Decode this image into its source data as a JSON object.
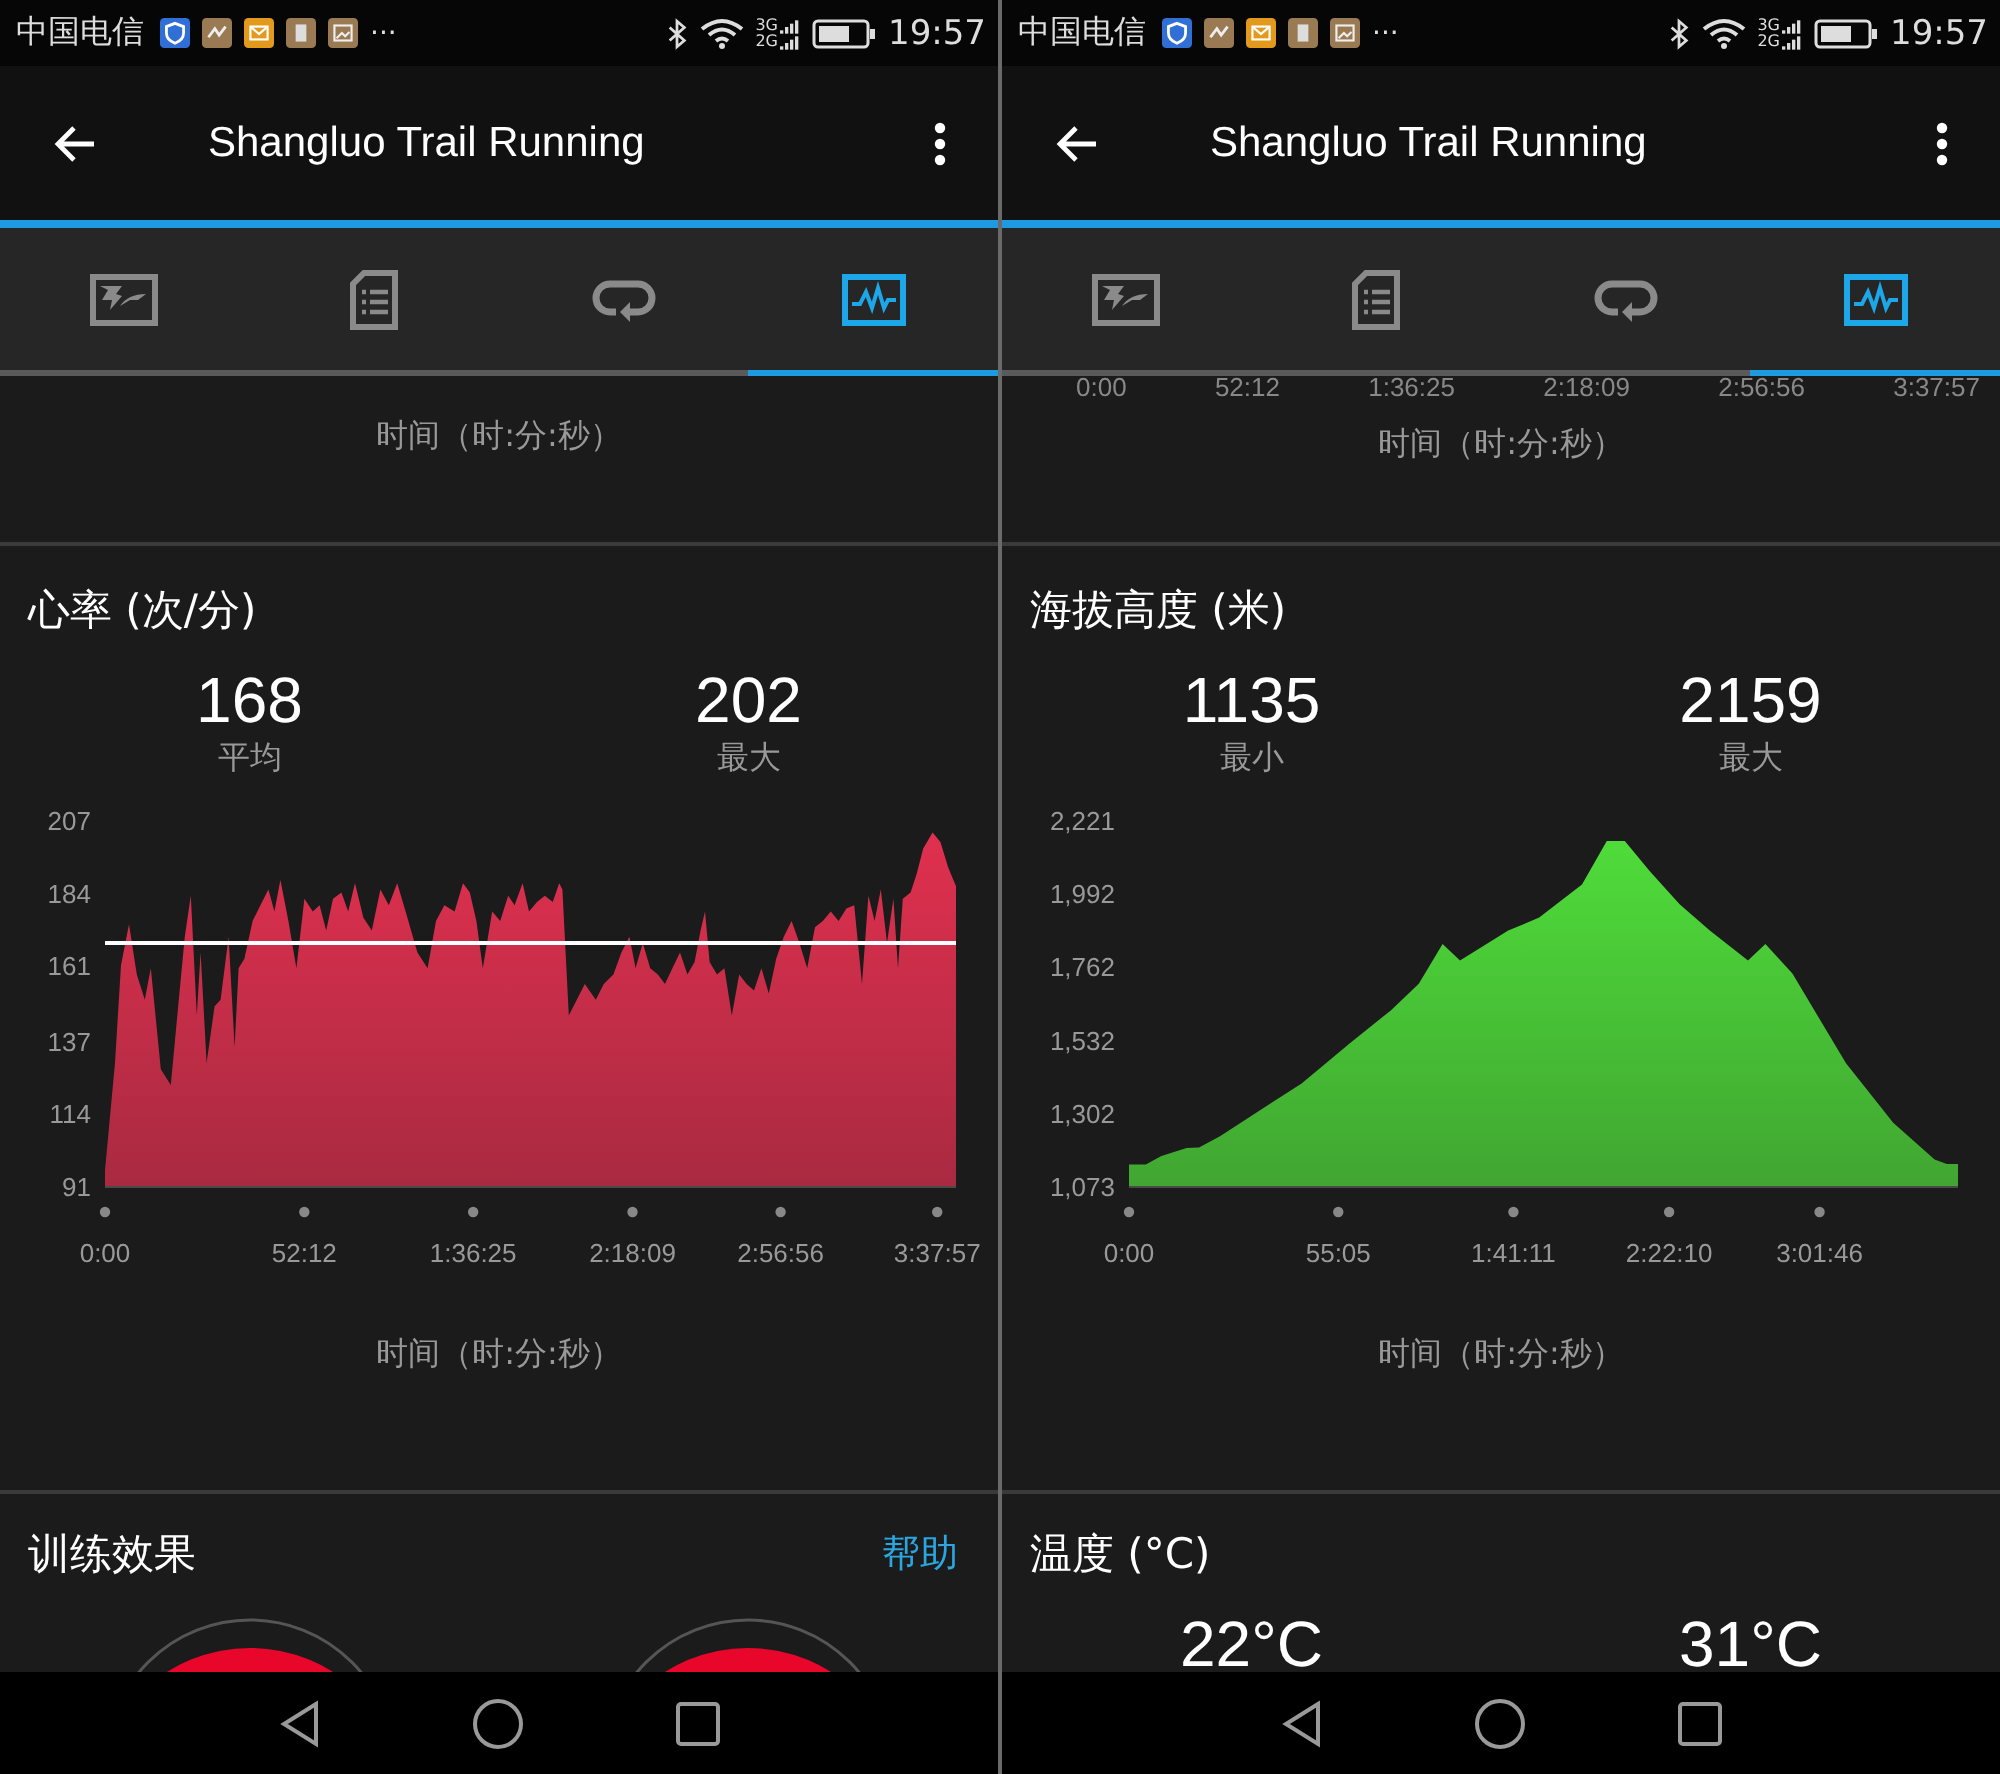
{
  "screens": [
    {
      "status_bar": {
        "carrier": "中国电信",
        "overflow": "···",
        "network_labels": [
          "3G",
          "2G"
        ],
        "time": "19:57"
      },
      "app_bar": {
        "title": "Shangluo Trail Running"
      },
      "tabs": [
        {
          "kind": "map",
          "selected": false
        },
        {
          "kind": "details",
          "selected": false
        },
        {
          "kind": "laps",
          "selected": false
        },
        {
          "kind": "charts",
          "selected": true
        }
      ],
      "previous_axis": {
        "title": "时间（时:分:秒）"
      },
      "chart_section": {
        "title": "心率 (次/分)",
        "stats": [
          {
            "value": "168",
            "label": "平均"
          },
          {
            "value": "202",
            "label": "最大"
          }
        ],
        "chart_data": {
          "type": "area",
          "xlim": [
            0,
            13372
          ],
          "ylim": [
            91,
            207
          ],
          "x": [
            0,
            157,
            251,
            376,
            501,
            626,
            720,
            877,
            1034,
            1159,
            1253,
            1347,
            1441,
            1503,
            1597,
            1723,
            1817,
            1942,
            2036,
            2098,
            2192,
            2318,
            2443,
            2568,
            2662,
            2756,
            2881,
            3007,
            3132,
            3265,
            3371,
            3477,
            3583,
            3716,
            3822,
            3928,
            4061,
            4193,
            4326,
            4459,
            4592,
            4724,
            4910,
            5069,
            5202,
            5334,
            5493,
            5626,
            5732,
            5835,
            5935,
            6085,
            6211,
            6336,
            6436,
            6561,
            6661,
            6787,
            6912,
            7037,
            7137,
            7187,
            7287,
            7413,
            7538,
            7713,
            7838,
            7989,
            8114,
            8239,
            8336,
            8452,
            8568,
            8685,
            8801,
            8917,
            9034,
            9150,
            9266,
            9359,
            9429,
            9499,
            9615,
            9732,
            9848,
            9964,
            10081,
            10197,
            10313,
            10429,
            10546,
            10665,
            10788,
            10911,
            11034,
            11157,
            11280,
            11404,
            11527,
            11650,
            11773,
            11896,
            11994,
            12093,
            12191,
            12289,
            12388,
            12462,
            12536,
            12659,
            12757,
            12856,
            13003,
            13126,
            13249,
            13372
          ],
          "series": [
            {
              "color": "#e0304f",
              "values": [
                96,
                130,
                161,
                174,
                158,
                150,
                160,
                128,
                123,
                150,
                170,
                183,
                145,
                165,
                130,
                148,
                150,
                170,
                135,
                160,
                163,
                175,
                180,
                185,
                178,
                188,
                175,
                160,
                182,
                178,
                180,
                172,
                182,
                184,
                178,
                187,
                176,
                172,
                185,
                180,
                187,
                178,
                165,
                160,
                175,
                180,
                178,
                187,
                184,
                175,
                160,
                178,
                175,
                183,
                180,
                187,
                178,
                181,
                183,
                181,
                187,
                185,
                145,
                150,
                155,
                150,
                155,
                158,
                165,
                170,
                160,
                168,
                160,
                158,
                155,
                160,
                165,
                158,
                162,
                172,
                178,
                162,
                158,
                160,
                145,
                158,
                155,
                153,
                160,
                152,
                163,
                170,
                175,
                168,
                160,
                173,
                175,
                178,
                175,
                179,
                180,
                155,
                183,
                175,
                185,
                168,
                182,
                160,
                182,
                184,
                190,
                198,
                203,
                200,
                192,
                186
              ]
            }
          ],
          "yticks": [
            91,
            114,
            137,
            161,
            184,
            207
          ],
          "xticks": [
            {
              "value": 0,
              "label": "0:00"
            },
            {
              "value": 3132,
              "label": "52:12"
            },
            {
              "value": 5785,
              "label": "1:36:25"
            },
            {
              "value": 8289,
              "label": "2:18:09"
            },
            {
              "value": 10616,
              "label": "2:56:56"
            },
            {
              "value": 13077,
              "label": "3:37:57"
            }
          ],
          "ref_lines": [
            {
              "axis": "y",
              "value": 168
            }
          ]
        },
        "axis_title": "时间（时:分:秒）"
      },
      "next_section": {
        "kind": "gauges",
        "title": "训练效果",
        "action": "帮助"
      }
    },
    {
      "status_bar": {
        "carrier": "中国电信",
        "overflow": "···",
        "network_labels": [
          "3G",
          "2G"
        ],
        "time": "19:57"
      },
      "app_bar": {
        "title": "Shangluo Trail Running"
      },
      "tabs": [
        {
          "kind": "map",
          "selected": false
        },
        {
          "kind": "details",
          "selected": false
        },
        {
          "kind": "laps",
          "selected": false
        },
        {
          "kind": "charts",
          "selected": true
        }
      ],
      "previous_axis": {
        "tick_labels": [
          "0:00",
          "52:12",
          "1:36:25",
          "2:18:09",
          "2:56:56",
          "3:37:57"
        ],
        "title": "时间（时:分:秒）"
      },
      "chart_section": {
        "title": "海拔高度 (米)",
        "stats": [
          {
            "value": "1135",
            "label": "最小"
          },
          {
            "value": "2159",
            "label": "最大"
          }
        ],
        "chart_data": {
          "type": "area",
          "xlim": [
            0,
            13092
          ],
          "ylim": [
            1073,
            2221
          ],
          "x": [
            0,
            264,
            512,
            909,
            1107,
            1438,
            2082,
            2727,
            3485,
            4135,
            4577,
            4951,
            5227,
            5988,
            6477,
            7153,
            7546,
            7829,
            8223,
            8696,
            9172,
            9777,
            10051,
            10478,
            11322,
            12070,
            12724,
            12914,
            13092
          ],
          "series": [
            {
              "color": "#4fdc3a",
              "values": [
                1140,
                1140,
                1167,
                1192,
                1194,
                1229,
                1312,
                1395,
                1520,
                1624,
                1707,
                1832,
                1780,
                1874,
                1915,
                2019,
                2155,
                2155,
                2061,
                1957,
                1874,
                1780,
                1832,
                1739,
                1458,
                1271,
                1156,
                1142,
                1142
              ]
            }
          ],
          "yticks": [
            {
              "value": 1073,
              "label": "1,073"
            },
            {
              "value": 1302,
              "label": "1,302"
            },
            {
              "value": 1532,
              "label": "1,532"
            },
            {
              "value": 1762,
              "label": "1,762"
            },
            {
              "value": 1992,
              "label": "1,992"
            },
            {
              "value": 2221,
              "label": "2,221"
            }
          ],
          "xticks": [
            {
              "value": 0,
              "label": "0:00"
            },
            {
              "value": 3305,
              "label": "55:05"
            },
            {
              "value": 6071,
              "label": "1:41:11"
            },
            {
              "value": 8530,
              "label": "2:22:10"
            },
            {
              "value": 10906,
              "label": "3:01:46"
            }
          ]
        },
        "axis_title": "时间（时:分:秒）"
      },
      "next_section": {
        "kind": "values",
        "title": "温度 (°C)",
        "values": [
          "22°C",
          "31°C"
        ]
      }
    }
  ]
}
